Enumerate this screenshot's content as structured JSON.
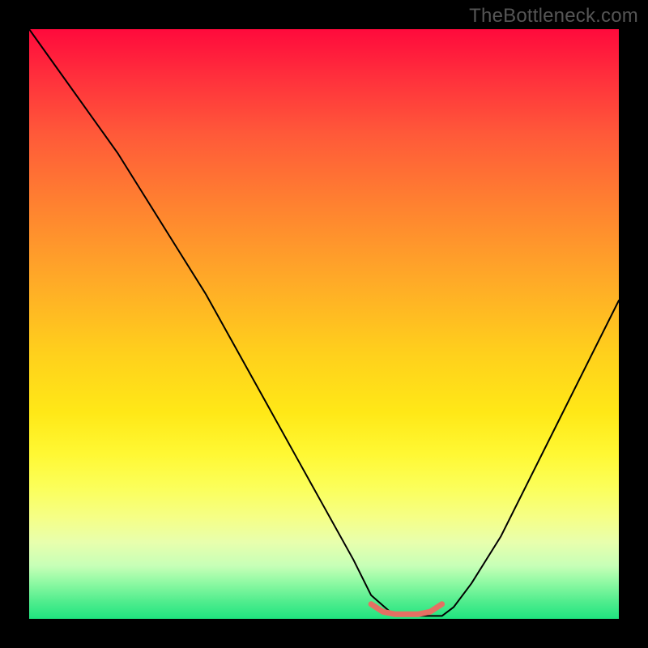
{
  "watermark": "TheBottleneck.com",
  "chart_data": {
    "type": "line",
    "title": "",
    "xlabel": "",
    "ylabel": "",
    "xlim": [
      0,
      100
    ],
    "ylim": [
      0,
      100
    ],
    "grid": false,
    "legend": false,
    "series": [
      {
        "name": "curve",
        "x": [
          0,
          5,
          10,
          15,
          20,
          25,
          30,
          35,
          40,
          45,
          50,
          55,
          58,
          62,
          66,
          70,
          72,
          75,
          80,
          85,
          90,
          95,
          100
        ],
        "values": [
          100,
          93,
          86,
          79,
          71,
          63,
          55,
          46,
          37,
          28,
          19,
          10,
          4,
          0.5,
          0.5,
          0.5,
          2,
          6,
          14,
          24,
          34,
          44,
          54
        ],
        "stroke": "#000000",
        "stroke_width": 2
      },
      {
        "name": "trough-highlight",
        "x": [
          58,
          60,
          62,
          64,
          66,
          68,
          70
        ],
        "values": [
          2.5,
          1.2,
          0.8,
          0.8,
          0.8,
          1.2,
          2.5
        ],
        "stroke": "#e57063",
        "stroke_width": 7
      }
    ],
    "background_gradient": {
      "top": "#ff0a3c",
      "mid": "#ffe817",
      "bottom": "#1fe47f"
    }
  }
}
